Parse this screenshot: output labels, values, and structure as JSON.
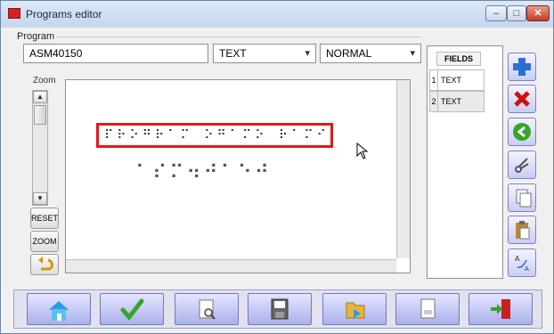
{
  "window": {
    "title": "Programs editor"
  },
  "program": {
    "group_label": "Program",
    "name": "ASM40150",
    "type": "TEXT",
    "mode": "NORMAL"
  },
  "zoom": {
    "label": "Zoom",
    "reset_label": "RESET",
    "zoom_label": "ZOOM"
  },
  "fields": {
    "header": "FIELDS",
    "rows": [
      {
        "num": "1",
        "label": "TEXT"
      },
      {
        "num": "2",
        "label": "TEXT"
      }
    ]
  },
  "colors": {
    "selection": "#e01a1a",
    "button_fill": "#c9cdf2",
    "add_icon": "#2b6fd4",
    "delete_icon": "#d01010",
    "ok_icon": "#36a52a"
  },
  "side_buttons": [
    "plus-icon",
    "x-icon",
    "back-arrow-icon",
    "scissors-icon",
    "copy-icon",
    "paste-icon",
    "font-size-icon"
  ],
  "bottom_buttons": [
    "home-icon",
    "check-icon",
    "preview-icon",
    "save-icon",
    "open-folder-icon",
    "document-icon",
    "exit-icon"
  ]
}
